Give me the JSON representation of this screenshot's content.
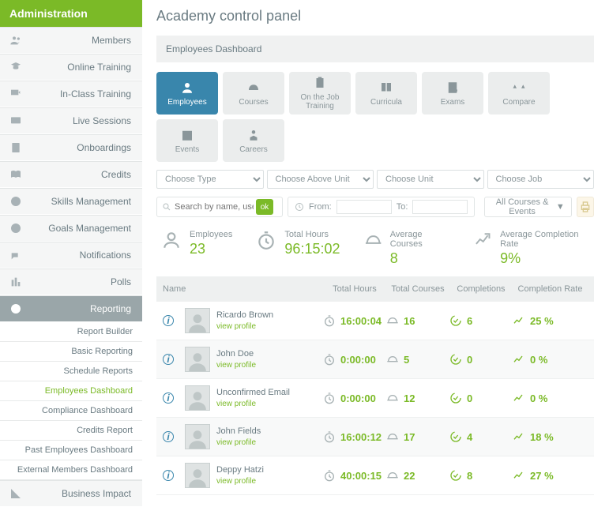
{
  "sidebar": {
    "header": "Administration",
    "items": [
      {
        "label": "Members",
        "icon": "members"
      },
      {
        "label": "Online Training",
        "icon": "training"
      },
      {
        "label": "In-Class Training",
        "icon": "inclass"
      },
      {
        "label": "Live Sessions",
        "icon": "live"
      },
      {
        "label": "Onboardings",
        "icon": "onboard"
      },
      {
        "label": "Credits",
        "icon": "credits"
      },
      {
        "label": "Skills Management",
        "icon": "skills"
      },
      {
        "label": "Goals Management",
        "icon": "goals"
      },
      {
        "label": "Notifications",
        "icon": "notif"
      },
      {
        "label": "Polls",
        "icon": "polls"
      },
      {
        "label": "Reporting",
        "icon": "reporting"
      }
    ],
    "sub_items": [
      {
        "label": "Report Builder"
      },
      {
        "label": "Basic Reporting"
      },
      {
        "label": "Schedule Reports"
      },
      {
        "label": "Employees Dashboard",
        "active": true
      },
      {
        "label": "Compliance Dashboard"
      },
      {
        "label": "Credits Report"
      },
      {
        "label": "Past Employees Dashboard"
      },
      {
        "label": "External Members Dashboard"
      }
    ],
    "footer": {
      "label": "Business Impact",
      "icon": "impact"
    }
  },
  "page": {
    "title": "Academy control panel",
    "subtitle": "Employees Dashboard"
  },
  "tabs": [
    {
      "label": "Employees",
      "icon": "user",
      "active": true
    },
    {
      "label": "Courses",
      "icon": "hardhat"
    },
    {
      "label": "On the Job Training",
      "icon": "clipboard"
    },
    {
      "label": "Curricula",
      "icon": "book"
    },
    {
      "label": "Exams",
      "icon": "exam"
    },
    {
      "label": "Compare",
      "icon": "scale"
    },
    {
      "label": "Events",
      "icon": "calendar"
    },
    {
      "label": "Careers",
      "icon": "career"
    }
  ],
  "filters": {
    "type": "Choose Type",
    "above_unit": "Choose Above Unit",
    "unit": "Choose Unit",
    "job": "Choose Job"
  },
  "toolbar": {
    "search_placeholder": "Search by name, username",
    "ok": "ok",
    "from_label": "From:",
    "to_label": "To:",
    "filter_dd": "All Courses & Events"
  },
  "stats": {
    "employees": {
      "label": "Employees",
      "value": "23"
    },
    "total_hours": {
      "label": "Total Hours",
      "value": "96:15:02"
    },
    "avg_courses": {
      "label": "Average Courses",
      "value": "8"
    },
    "avg_completion": {
      "label": "Average Completion Rate",
      "value": "9%"
    }
  },
  "table": {
    "headers": {
      "name": "Name",
      "hours": "Total Hours",
      "courses": "Total Courses",
      "completions": "Completions",
      "rate": "Completion Rate"
    },
    "view_profile": "view profile",
    "rows": [
      {
        "name": "Ricardo Brown",
        "hours": "16:00:04",
        "courses": "16",
        "completions": "6",
        "rate": "25 %"
      },
      {
        "name": "John Doe",
        "hours": "0:00:00",
        "courses": "5",
        "completions": "0",
        "rate": "0 %"
      },
      {
        "name": "Unconfirmed Email",
        "hours": "0:00:00",
        "courses": "12",
        "completions": "0",
        "rate": "0 %"
      },
      {
        "name": "John Fields",
        "hours": "16:00:12",
        "courses": "17",
        "completions": "4",
        "rate": "18 %"
      },
      {
        "name": "Deppy Hatzi",
        "hours": "40:00:15",
        "courses": "22",
        "completions": "8",
        "rate": "27 %"
      }
    ]
  }
}
